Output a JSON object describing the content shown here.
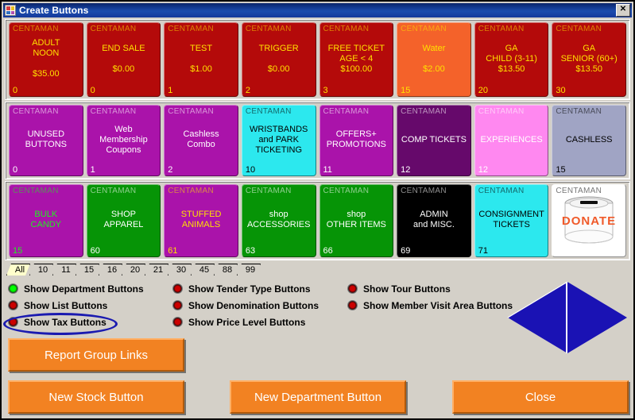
{
  "window": {
    "title": "Create Buttons",
    "icon": "app-squares-icon",
    "close_label": "✕",
    "icon_colors": [
      "#d84040",
      "#e8c020",
      "#3070c0",
      "#b050b0"
    ]
  },
  "grid": {
    "header_text": "CENTAMAN",
    "rows": [
      [
        {
          "label": "ADULT\nNOON\n\n$35.00",
          "index": "0",
          "bg": "#b40a0a",
          "fg": "#ffe000"
        },
        {
          "label": "END SALE\n\n$0.00",
          "index": "0",
          "bg": "#b40a0a",
          "fg": "#ffe000"
        },
        {
          "label": "TEST\n\n$1.00",
          "index": "1",
          "bg": "#b40a0a",
          "fg": "#ffe000"
        },
        {
          "label": "TRIGGER\n\n$0.00",
          "index": "2",
          "bg": "#b40a0a",
          "fg": "#ffe000"
        },
        {
          "label": "FREE TICKET\nAGE < 4\n$100.00",
          "index": "3",
          "bg": "#b40a0a",
          "fg": "#ffe000"
        },
        {
          "label": "Water\n\n$2.00",
          "index": "15",
          "bg": "#f4622a",
          "fg": "#ffe000"
        },
        {
          "label": "GA\nCHILD (3-11)\n$13.50",
          "index": "20",
          "bg": "#b40a0a",
          "fg": "#ffe000"
        },
        {
          "label": "GA\nSENIOR (60+)\n$13.50",
          "index": "30",
          "bg": "#b40a0a",
          "fg": "#ffe000"
        }
      ],
      [
        {
          "label": "UNUSED\nBUTTONS",
          "index": "0",
          "bg": "#aa13aa",
          "fg": "#ffffff"
        },
        {
          "label": "Web Membership\nCoupons",
          "index": "1",
          "bg": "#aa13aa",
          "fg": "#ffffff"
        },
        {
          "label": "Cashless\nCombo",
          "index": "2",
          "bg": "#aa13aa",
          "fg": "#ffffff"
        },
        {
          "label": "WRISTBANDS\nand PARK\nTICKETING",
          "index": "10",
          "bg": "#2ce8ee",
          "fg": "#000000"
        },
        {
          "label": "OFFERS+\nPROMOTIONS",
          "index": "11",
          "bg": "#aa13aa",
          "fg": "#ffffff"
        },
        {
          "label": "COMP TICKETS",
          "index": "12",
          "bg": "#66096b",
          "fg": "#ffffff"
        },
        {
          "label": "EXPERIENCES",
          "index": "12",
          "bg": "#ff88f0",
          "fg": "#ffffff"
        },
        {
          "label": "CASHLESS",
          "index": "15",
          "bg": "#a0a4c4",
          "fg": "#000000"
        }
      ],
      [
        {
          "label": "BULK\nCANDY",
          "index": "15",
          "bg": "#aa13aa",
          "fg": "#22ee22"
        },
        {
          "label": "SHOP\nAPPAREL",
          "index": "60",
          "bg": "#069406",
          "fg": "#ffffff"
        },
        {
          "label": "STUFFED\nANIMALS",
          "index": "61",
          "bg": "#aa13aa",
          "fg": "#ffe000"
        },
        {
          "label": "shop\nACCESSORIES",
          "index": "63",
          "bg": "#069406",
          "fg": "#ffffff"
        },
        {
          "label": "shop\nOTHER ITEMS",
          "index": "66",
          "bg": "#069406",
          "fg": "#ffffff"
        },
        {
          "label": "ADMIN\nand MISC.",
          "index": "69",
          "bg": "#000000",
          "fg": "#ffffff"
        },
        {
          "label": "CONSIGNMENT\nTICKETS",
          "index": "71",
          "bg": "#2ce8ee",
          "fg": "#000000"
        },
        {
          "label": "",
          "index": "",
          "bg": "#ffffff",
          "fg": "#000000",
          "image": "donate-can-image",
          "image_text": "DONATE"
        }
      ]
    ]
  },
  "tabs": {
    "selected": "All",
    "items": [
      "All",
      "10",
      "11",
      "15",
      "16",
      "20",
      "21",
      "30",
      "45",
      "88",
      "99"
    ]
  },
  "options": {
    "columns": [
      [
        {
          "label": "Show Department Buttons",
          "state": "on"
        },
        {
          "label": "Show List Buttons",
          "state": "off"
        },
        {
          "label": "Show Tax Buttons",
          "state": "off",
          "highlighted": true
        }
      ],
      [
        {
          "label": "Show Tender Type Buttons",
          "state": "off"
        },
        {
          "label": "Show Denomination Buttons",
          "state": "off"
        },
        {
          "label": "Show Price Level Buttons",
          "state": "off"
        }
      ],
      [
        {
          "label": "Show Tour Buttons",
          "state": "off"
        },
        {
          "label": "Show Member Visit Area Buttons",
          "state": "off"
        }
      ]
    ]
  },
  "actions": {
    "report_group_links": "Report Group Links",
    "new_stock_button": "New Stock Button",
    "new_department_button": "New Department Button",
    "close": "Close"
  },
  "decoration": {
    "diamond_color": "#1a12b4"
  }
}
